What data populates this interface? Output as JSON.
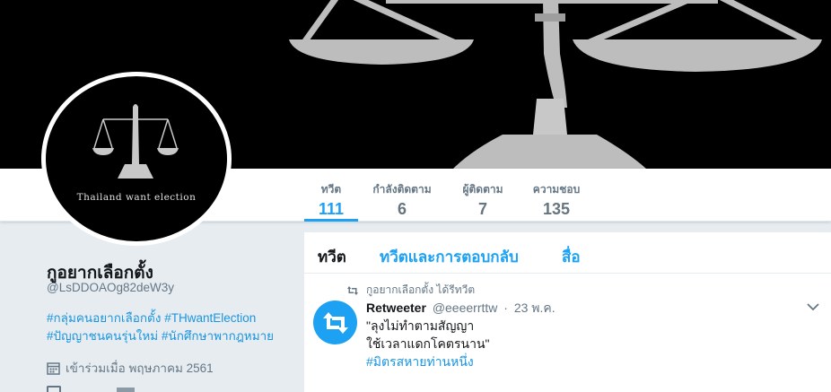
{
  "profile": {
    "name": "กูอยากเลือกตั้ง",
    "handle": "@LsDDOAOg82deW3y",
    "avatar_text": "Thailand want election",
    "bio_tags_line1": [
      "#กลุ่มคนอยากเลือกตั้ง",
      "#THwantElection"
    ],
    "bio_tags_line2": [
      "#ปัญญาชนคนรุ่นใหม่",
      "#นักศึกษาพากฎหมาย"
    ],
    "joined": "เข้าร่วมเมื่อ พฤษภาคม 2561",
    "joined_icon": "calendar-icon"
  },
  "stats": [
    {
      "label": "ทวีต",
      "value": "111"
    },
    {
      "label": "กำลังติดตาม",
      "value": "6"
    },
    {
      "label": "ผู้ติดตาม",
      "value": "7"
    },
    {
      "label": "ความชอบ",
      "value": "135"
    }
  ],
  "timeline": {
    "tabs": [
      "ทวีต",
      "ทวีตและการตอบกลับ",
      "สื่อ"
    ],
    "tweet": {
      "context": "กูอยากเลือกตั้ง ได้รีทวีต",
      "context_icon": "retweet-icon",
      "author": "Retweeter",
      "author_handle": "@eeeerrttw",
      "dot": "·",
      "date": "23 พ.ค.",
      "line1": "\"ลุงไม่ทำตามสัญญา",
      "line2": "ใช้เวลาแดกโคตรนาน\"",
      "line3": "#มิตรสหายท่านหนึ่ง"
    }
  },
  "colors": {
    "accent": "#1da1f2",
    "banner": "#000000",
    "scale": "#bdbdbd"
  }
}
